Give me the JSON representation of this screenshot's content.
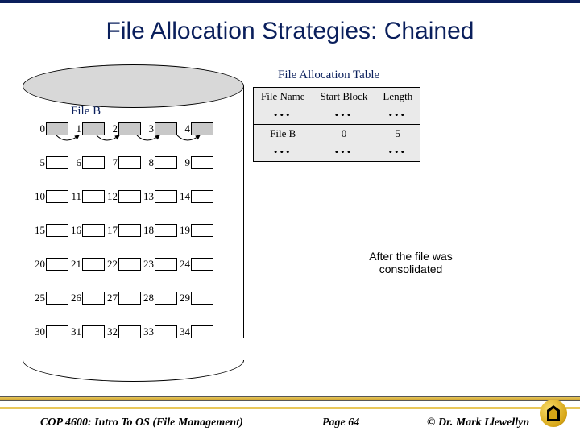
{
  "title": "File Allocation Strategies: Chained",
  "disk": {
    "file_label": "File B",
    "rows": [
      [
        {
          "n": "0",
          "f": true
        },
        {
          "n": "1",
          "f": true
        },
        {
          "n": "2",
          "f": true
        },
        {
          "n": "3",
          "f": true
        },
        {
          "n": "4",
          "f": true
        }
      ],
      [
        {
          "n": "5",
          "f": false
        },
        {
          "n": "6",
          "f": false
        },
        {
          "n": "7",
          "f": false
        },
        {
          "n": "8",
          "f": false
        },
        {
          "n": "9",
          "f": false
        }
      ],
      [
        {
          "n": "10",
          "f": false
        },
        {
          "n": "11",
          "f": false
        },
        {
          "n": "12",
          "f": false
        },
        {
          "n": "13",
          "f": false
        },
        {
          "n": "14",
          "f": false
        }
      ],
      [
        {
          "n": "15",
          "f": false
        },
        {
          "n": "16",
          "f": false
        },
        {
          "n": "17",
          "f": false
        },
        {
          "n": "18",
          "f": false
        },
        {
          "n": "19",
          "f": false
        }
      ],
      [
        {
          "n": "20",
          "f": false
        },
        {
          "n": "21",
          "f": false
        },
        {
          "n": "22",
          "f": false
        },
        {
          "n": "23",
          "f": false
        },
        {
          "n": "24",
          "f": false
        }
      ],
      [
        {
          "n": "25",
          "f": false
        },
        {
          "n": "26",
          "f": false
        },
        {
          "n": "27",
          "f": false
        },
        {
          "n": "28",
          "f": false
        },
        {
          "n": "29",
          "f": false
        }
      ],
      [
        {
          "n": "30",
          "f": false
        },
        {
          "n": "31",
          "f": false
        },
        {
          "n": "32",
          "f": false
        },
        {
          "n": "33",
          "f": false
        },
        {
          "n": "34",
          "f": false
        }
      ]
    ]
  },
  "fat": {
    "title": "File Allocation Table",
    "headers": [
      "File Name",
      "Start Block",
      "Length"
    ],
    "rows": [
      [
        "•••",
        "•••",
        "•••"
      ],
      [
        "File B",
        "0",
        "5"
      ],
      [
        "•••",
        "•••",
        "•••"
      ]
    ]
  },
  "caption": "After the file was consolidated",
  "footer": {
    "course": "COP 4600: Intro To OS  (File Management)",
    "page": "Page 64",
    "author": "© Dr. Mark Llewellyn"
  }
}
